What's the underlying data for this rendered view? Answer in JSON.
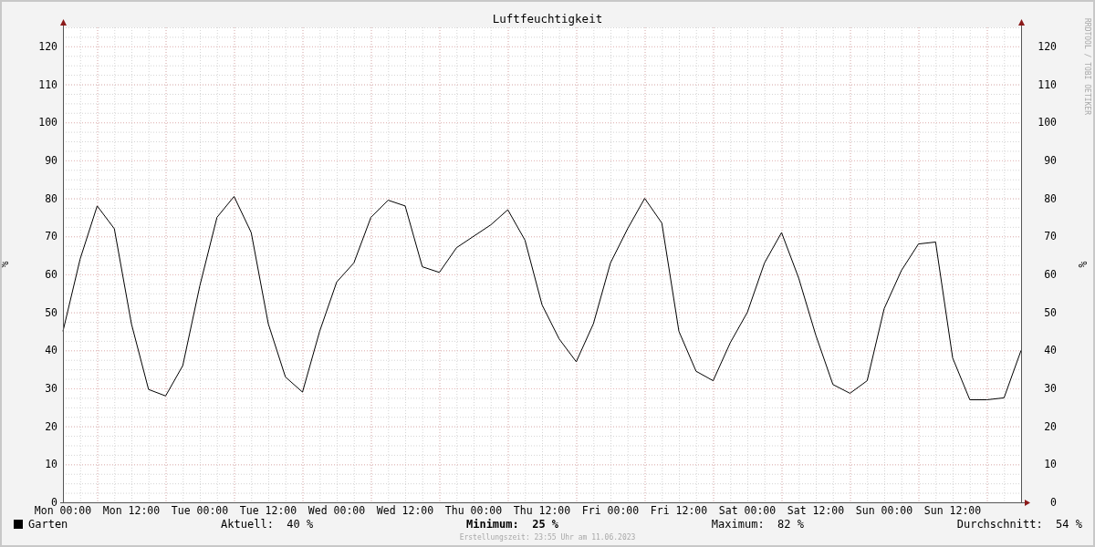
{
  "title": "Luftfeuchtigkeit",
  "credit": "RRDTOOL / TOBI OETIKER",
  "chart_data": {
    "type": "line",
    "grid": true,
    "ylabel": "%",
    "ylim": [
      0,
      125
    ],
    "categories": [
      "Mon 00:00",
      null,
      null,
      null,
      "Mon 12:00",
      null,
      null,
      null,
      "Tue 00:00",
      null,
      null,
      null,
      "Tue 12:00",
      null,
      null,
      null,
      "Wed 00:00",
      null,
      null,
      null,
      "Wed 12:00",
      null,
      null,
      null,
      "Thu 00:00",
      null,
      null,
      null,
      "Thu 12:00",
      null,
      null,
      null,
      "Fri 00:00",
      null,
      null,
      null,
      "Fri 12:00",
      null,
      null,
      null,
      "Sat 00:00",
      null,
      null,
      null,
      "Sat 12:00",
      null,
      null,
      null,
      "Sun 00:00",
      null,
      null,
      null,
      "Sun 12:00",
      null,
      null,
      null,
      null
    ],
    "series": [
      {
        "name": "Garten",
        "color": "#000000",
        "values": [
          45,
          64,
          78,
          72,
          47,
          29.7,
          28,
          36,
          57,
          75,
          80.5,
          71,
          47,
          33,
          29,
          45,
          58,
          63,
          75,
          79.5,
          78,
          62,
          60.5,
          67,
          70,
          73,
          77,
          69,
          52,
          43,
          37,
          47,
          63,
          72,
          80,
          73.5,
          45,
          34.5,
          32,
          42,
          50,
          63,
          71,
          59,
          44,
          31,
          28.7,
          32,
          51,
          61,
          68,
          68.5,
          38,
          27,
          27,
          27.5,
          40
        ]
      }
    ],
    "yticks": [
      0,
      10,
      20,
      30,
      40,
      50,
      60,
      70,
      80,
      90,
      100,
      110,
      120
    ]
  },
  "right_axis": {
    "label": "%",
    "ticks": [
      "120",
      "110",
      "100",
      "90",
      "80",
      "70",
      "60",
      "50",
      "40",
      "30",
      "20",
      "10",
      "0"
    ]
  },
  "legend": {
    "stats": [
      {
        "label": "Aktuell:",
        "value": "40 %",
        "bold": false
      },
      {
        "label": "Minimum:",
        "value": "25 %",
        "bold": true
      },
      {
        "label": "Maximum:",
        "value": "82 %",
        "bold": false
      },
      {
        "label": "Durchschnitt:",
        "value": "54 %",
        "bold": false
      }
    ]
  },
  "footer": "Erstellungszeit: 23:55 Uhr am 11.06.2023"
}
